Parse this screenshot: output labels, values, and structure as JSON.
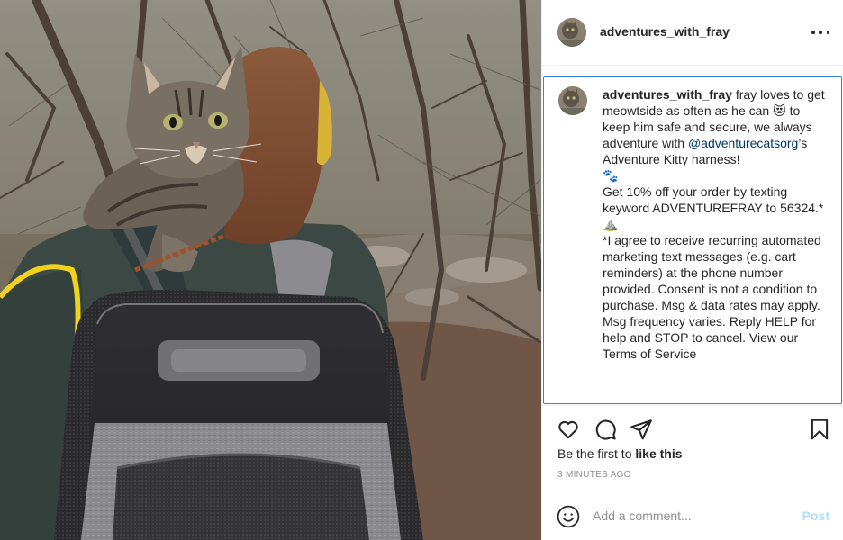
{
  "post": {
    "username": "adventures_with_fray",
    "more_icon": "more-horizontal-icon"
  },
  "caption": {
    "username": "adventures_with_fray",
    "text_1": " fray loves to get meowtside as often as he can 😻 to keep him safe and secure, we always adventure with ",
    "mention": "@adventurecatsorg",
    "text_2": "’s Adventure Kitty harness!\n🐾\nGet 10% off your order by texting keyword ADVENTUREFRAY to 56324.*\n⛰️\n*I agree to receive recurring automated marketing text messages (e.g. cart reminders) at the phone number provided. Consent is not a condition to purchase. Msg & data rates may apply. Msg frequency varies. Reply HELP for help and STOP to cancel. View our Terms of Service"
  },
  "actions": {
    "like_icon": "heart-icon",
    "comment_icon": "comment-icon",
    "share_icon": "share-icon",
    "save_icon": "bookmark-icon"
  },
  "likes": {
    "prefix": "Be the first to ",
    "link": "like this"
  },
  "timestamp": "3 MINUTES AGO",
  "comment_box": {
    "placeholder": "Add a comment...",
    "post_label": "Post",
    "emoji_icon": "emoji-icon"
  },
  "colors": {
    "accent": "#0095f6",
    "post_disabled": "#b2dffc",
    "caption_border": "#3b7ddd",
    "mention": "#00376b",
    "muted": "#8e8e8e"
  }
}
